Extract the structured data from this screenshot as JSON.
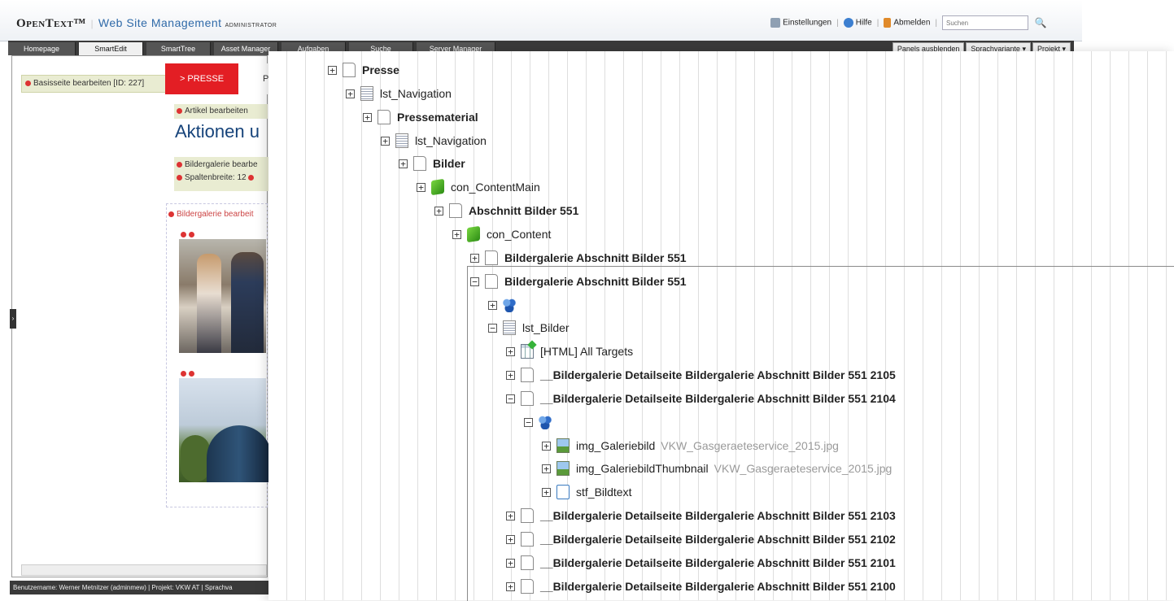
{
  "header": {
    "brand": "OpenText™",
    "product": "Web Site Management",
    "role": "ADMINISTRATOR",
    "links": {
      "settings": "Einstellungen",
      "help": "Hilfe",
      "logout": "Abmelden"
    },
    "search_placeholder": "Suchen"
  },
  "tabs": [
    "Homepage",
    "SmartEdit",
    "SmartTree",
    "Asset Manager",
    "Aufgaben",
    "Suche",
    "Server Manager"
  ],
  "toolbar": {
    "hide_panels": "Panels ausblenden",
    "language_variant": "Sprachvariante ▾",
    "project": "Projekt ▾"
  },
  "smartedit": {
    "base_page": "Basisseite bearbeiten [ID: 227]",
    "nav_tab": "> PRESSE",
    "nav_tab2": "P",
    "edit_article": "Artikel bearbeiten",
    "heading": "Aktionen u",
    "gallery_edit": "Bildergalerie bearbe",
    "column_width": "Spaltenbreite: 12",
    "gallery_edit2": "Bildergalerie bearbeit"
  },
  "statusbar": "Benutzername: Werner Metnitzer (adminmew)  |  Projekt: VKW AT  |  Sprachva",
  "tree": [
    {
      "label": "Presse",
      "bold": true,
      "icon": "page-icon"
    },
    {
      "label": "lst_Navigation",
      "bold": false,
      "icon": "list-icon"
    },
    {
      "label": "Pressematerial",
      "bold": true,
      "icon": "page-icon"
    },
    {
      "label": "lst_Navigation",
      "bold": false,
      "icon": "list-icon"
    },
    {
      "label": "Bilder",
      "bold": true,
      "icon": "page-icon"
    },
    {
      "label": "con_ContentMain",
      "bold": false,
      "icon": "container-icon"
    },
    {
      "label": "Abschnitt Bilder 551",
      "bold": true,
      "icon": "page-icon"
    },
    {
      "label": "con_Content",
      "bold": false,
      "icon": "container-icon"
    },
    {
      "label": "Bildergalerie Abschnitt Bilder 551",
      "bold": true,
      "icon": "page-icon"
    },
    {
      "label": "Bildergalerie Abschnitt Bilder 551",
      "bold": true,
      "icon": "page-icon"
    },
    {
      "label": "",
      "bold": false,
      "icon": "elements-icon"
    },
    {
      "label": "lst_Bilder",
      "bold": false,
      "icon": "list-icon"
    },
    {
      "label": "[HTML] All Targets",
      "bold": false,
      "icon": "target-icon"
    },
    {
      "label": "__Bildergalerie Detailseite Bildergalerie Abschnitt Bilder 551 2105",
      "bold": true,
      "icon": "page-icon"
    },
    {
      "label": "__Bildergalerie Detailseite Bildergalerie Abschnitt Bilder 551 2104",
      "bold": true,
      "icon": "page-icon"
    },
    {
      "label": "",
      "bold": false,
      "icon": "elements-icon"
    },
    {
      "label": "img_Galeriebild",
      "bold": false,
      "icon": "image-icon",
      "file": "VKW_Gasgeraeteservice_2015.jpg"
    },
    {
      "label": "img_GaleriebildThumbnail",
      "bold": false,
      "icon": "image-icon",
      "file": "VKW_Gasgeraeteservice_2015.jpg"
    },
    {
      "label": "stf_Bildtext",
      "bold": false,
      "icon": "text-icon"
    },
    {
      "label": "__Bildergalerie Detailseite Bildergalerie Abschnitt Bilder 551 2103",
      "bold": true,
      "icon": "page-icon"
    },
    {
      "label": "__Bildergalerie Detailseite Bildergalerie Abschnitt Bilder 551 2102",
      "bold": true,
      "icon": "page-icon"
    },
    {
      "label": "__Bildergalerie Detailseite Bildergalerie Abschnitt Bilder 551 2101",
      "bold": true,
      "icon": "page-icon"
    },
    {
      "label": "__Bildergalerie Detailseite Bildergalerie Abschnitt Bilder 551 2100",
      "bold": true,
      "icon": "page-icon"
    }
  ],
  "colors": {
    "accent_red": "#e31e24",
    "brand_blue": "#2f6aa8"
  }
}
